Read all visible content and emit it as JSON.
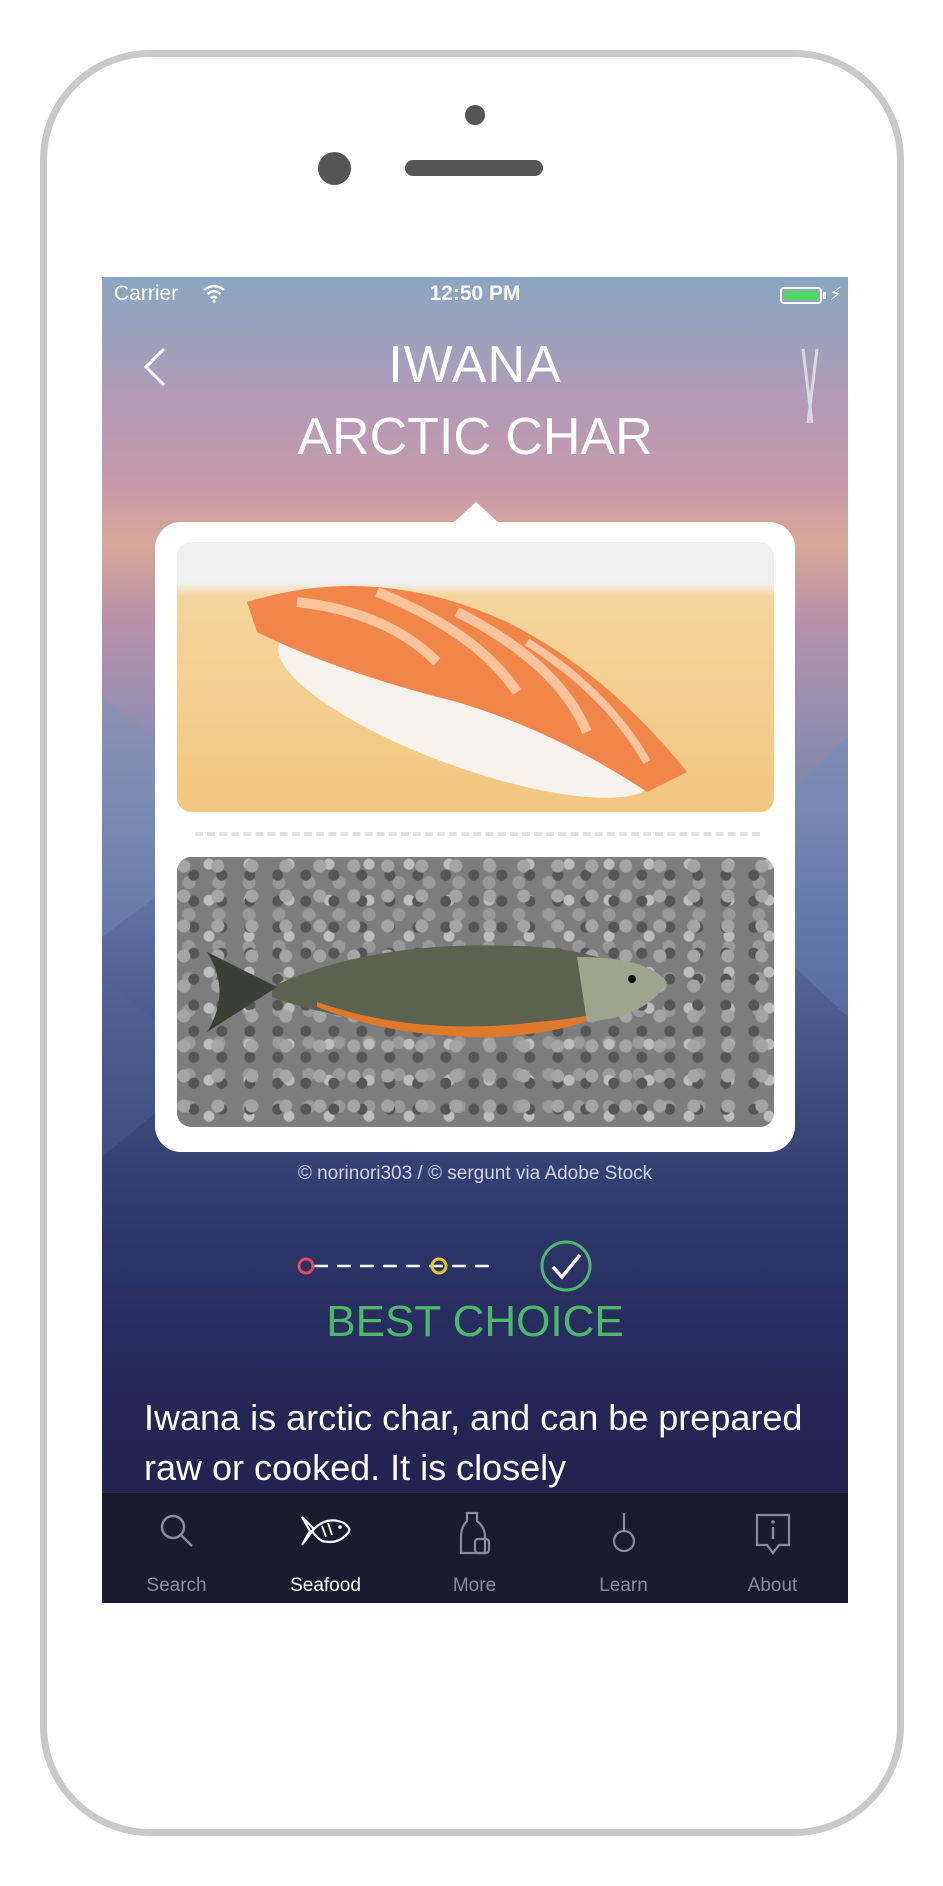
{
  "status_bar": {
    "carrier": "Carrier",
    "time": "12:50 PM"
  },
  "header": {
    "title_japanese": "IWANA",
    "title_english": "ARCTIC CHAR"
  },
  "images": {
    "credit": "© norinori303 / © sergunt via Adobe Stock"
  },
  "rating": {
    "label": "BEST CHOICE",
    "colors": {
      "avoid": "#e04a5f",
      "good": "#e8c52a",
      "best": "#4cb96a"
    }
  },
  "description": {
    "text": "Iwana is arctic char, and can be prepared raw or cooked. It is closely"
  },
  "tabbar": {
    "items": [
      {
        "label": "Search",
        "icon": "search-icon"
      },
      {
        "label": "Seafood",
        "icon": "fish-icon"
      },
      {
        "label": "More",
        "icon": "sake-icon"
      },
      {
        "label": "Learn",
        "icon": "hook-icon"
      },
      {
        "label": "About",
        "icon": "info-icon"
      }
    ],
    "active": "Seafood"
  }
}
